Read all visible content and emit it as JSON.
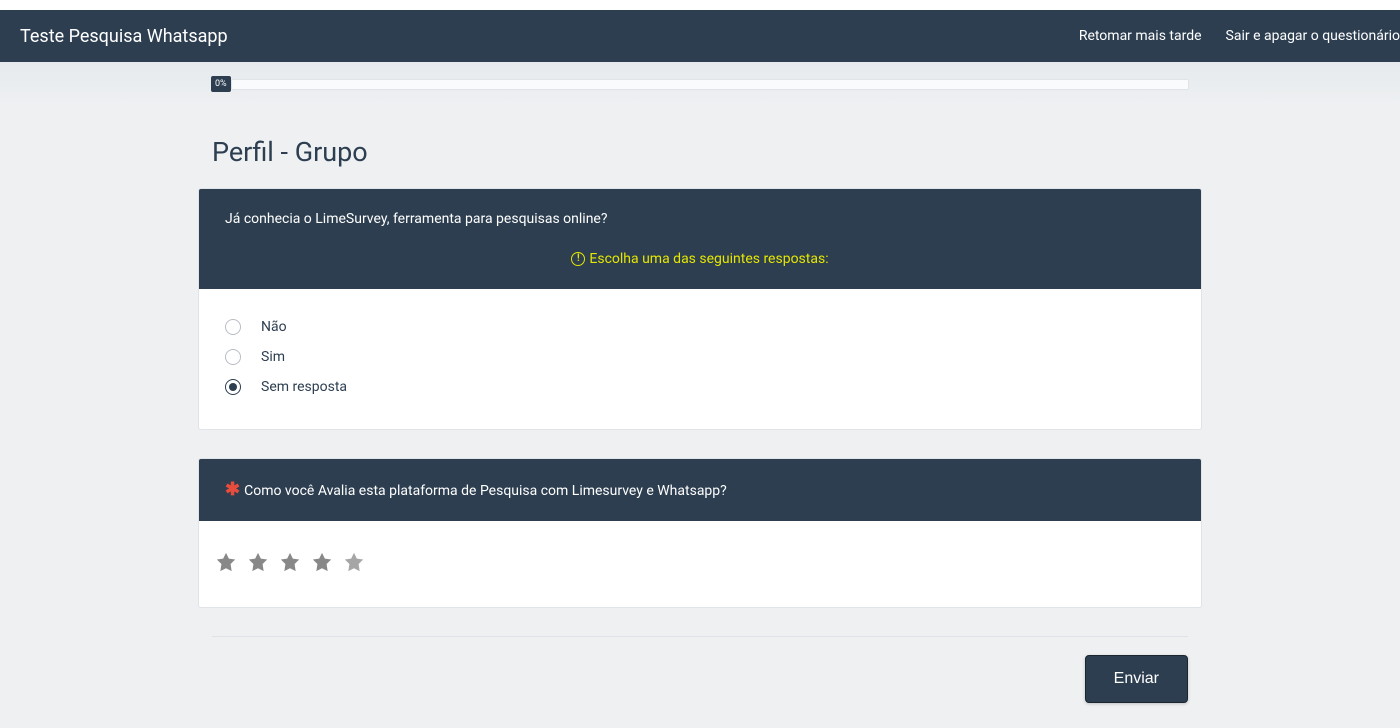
{
  "navbar": {
    "brand": "Teste Pesquisa Whatsapp",
    "links": {
      "resume": "Retomar mais tarde",
      "exit": "Sair e apagar o questionário"
    }
  },
  "progress": {
    "percent_label": "0%"
  },
  "group": {
    "title": "Perfil - Grupo"
  },
  "question1": {
    "text": "Já conhecia o LimeSurvey, ferramenta para pesquisas online?",
    "help": "Escolha uma das seguintes respostas:",
    "options": {
      "no": "Não",
      "yes": "Sim",
      "noanswer": "Sem resposta"
    },
    "selected": "noanswer"
  },
  "question2": {
    "text": "Como você Avalia esta plataforma de Pesquisa com Limesurvey e Whatsapp?",
    "required": true,
    "star_count": 5
  },
  "buttons": {
    "submit": "Enviar"
  }
}
